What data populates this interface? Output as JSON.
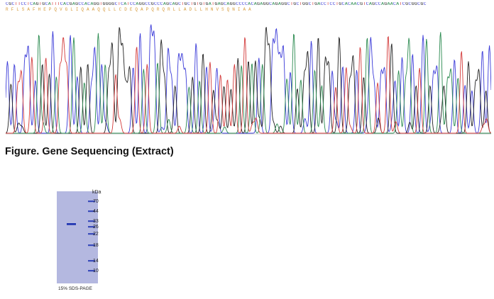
{
  "sequencing": {
    "dna_sequence": "CGCTTCCTCAGTGCATTTCACGAGCCACAGGTGGGGCTCATCCAGGCCGCCCAGCAGCTGCTGTGTGATGAGCAGGCCCCACAGAGGCAGAGGCTGCTGGCTGACCTCCTGCACAACGTCAGCCAGAACATCGCGGCGC",
    "amino_acid_sequence": "R F L S A F H E P Q V G L I Q A A Q Q L L C D E Q A P Q R Q R L L A D L L H N V S Q N I A A",
    "colors": {
      "A": "#2a8a4f",
      "C": "#3a3ad8",
      "G": "#222222",
      "T": "#d33a3a"
    }
  },
  "figure_caption": "Figure. Gene Sequencing (Extract)",
  "gel": {
    "unit_label": "kDa",
    "markers": [
      "70",
      "44",
      "33",
      "26",
      "22",
      "18",
      "14",
      "10"
    ],
    "caption": "15% SDS-PAGE",
    "colors": {
      "background": "#b4b8e0",
      "band": "#1a2fb0"
    }
  }
}
